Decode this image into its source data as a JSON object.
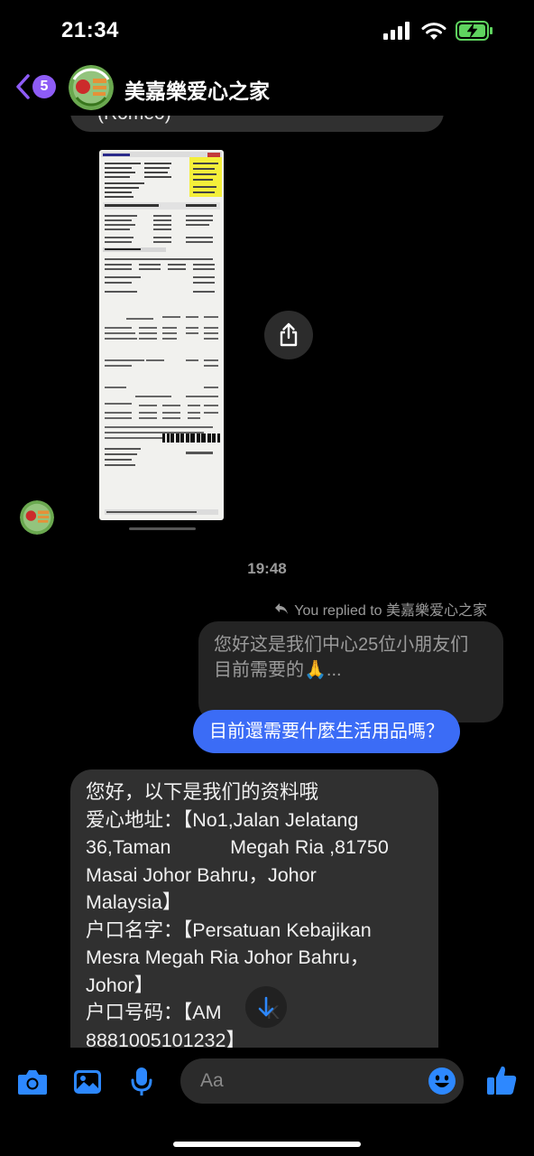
{
  "status_bar": {
    "time": "21:34"
  },
  "header": {
    "back_badge": "5",
    "title": "美嘉樂爱心之家"
  },
  "chat": {
    "previous_message_fragment": "(Romeo)",
    "timestamp": "19:48",
    "replied_to_label": "You replied to 美嘉樂爱心之家",
    "quoted_message_lines": [
      "您好这是我们中心25位小朋友们",
      "目前需要的🙏..."
    ],
    "sent_message": "目前還需要什麼生活用品嗎？",
    "received_message": {
      "line1": "您好，以下是我们的资料哦",
      "line2": "爱心地址：【No1,Jalan Jelatang",
      "line3": "36,Taman           Megah Ria ,81750",
      "line4": "Masai Johor Bahru，Johor",
      "line5": "Malaysia】",
      "line6": "户口名字：【Persatuan Kebajikan",
      "line7": "Mesra Megah Ria Johor Bahru，",
      "line8": "Johor】",
      "line9": "户口号码：【AM",
      "line9_tail": "K",
      "line10": "8881005101232】"
    }
  },
  "composer": {
    "placeholder": "Aa"
  },
  "colors": {
    "accent": "#3b6cf6",
    "back_badge": "#8e5cf6",
    "icon_blue": "#2d88ff",
    "bubble_received": "#303030",
    "background": "#000000"
  },
  "icons": [
    "signal-icon",
    "wifi-icon",
    "battery-charging-icon",
    "chevron-left-icon",
    "share-icon",
    "reply-icon",
    "arrow-down-icon",
    "camera-icon",
    "gallery-icon",
    "microphone-icon",
    "emoji-icon",
    "thumbs-up-icon"
  ]
}
